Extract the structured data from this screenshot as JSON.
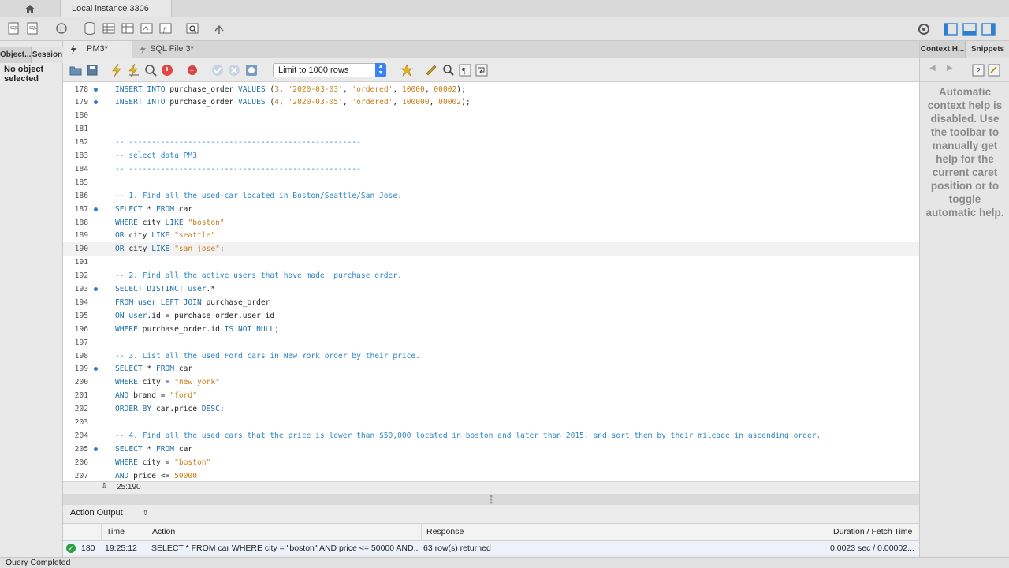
{
  "app": {
    "connection_tab": "Local instance 3306"
  },
  "left_panel": {
    "tab_objects": "Object...",
    "tab_session": "Session",
    "empty_text": "No object selected"
  },
  "editor_tabs": [
    {
      "label": "PM3*"
    },
    {
      "label": "SQL File 3*"
    }
  ],
  "editor_toolbar": {
    "limit_value": "Limit to 1000 rows"
  },
  "code_lines": [
    {
      "n": "178",
      "dot": true,
      "html": "<span class='kw'>INSERT INTO</span> purchase_order <span class='kw'>VALUES</span> (<span class='num'>3</span>, <span class='str'>'2020-03-03'</span>, <span class='str'>'ordered'</span>, <span class='num'>10000</span>, <span class='num'>00002</span>);"
    },
    {
      "n": "179",
      "dot": true,
      "html": "<span class='kw'>INSERT INTO</span> purchase_order <span class='kw'>VALUES</span> (<span class='num'>4</span>, <span class='str'>'2020-03-05'</span>, <span class='str'>'ordered'</span>, <span class='num'>100000</span>, <span class='num'>00002</span>);"
    },
    {
      "n": "180",
      "dot": false,
      "html": ""
    },
    {
      "n": "181",
      "dot": false,
      "html": ""
    },
    {
      "n": "182",
      "dot": false,
      "html": "<span class='cm'>-- ---------------------------------------------------</span>"
    },
    {
      "n": "183",
      "dot": false,
      "html": "<span class='cm'>-- select data PM3</span>"
    },
    {
      "n": "184",
      "dot": false,
      "html": "<span class='cm'>-- ---------------------------------------------------</span>"
    },
    {
      "n": "185",
      "dot": false,
      "html": ""
    },
    {
      "n": "186",
      "dot": false,
      "html": "<span class='cm'>-- 1. Find all the used-car located in Boston/Seattle/San Jose.</span>"
    },
    {
      "n": "187",
      "dot": true,
      "html": "<span class='kw'>SELECT</span> * <span class='kw'>FROM</span> car"
    },
    {
      "n": "188",
      "dot": false,
      "html": "<span class='kw'>WHERE</span> city <span class='kw'>LIKE</span> <span class='str'>\"boston\"</span>"
    },
    {
      "n": "189",
      "dot": false,
      "html": "<span class='kw'>OR</span> city <span class='kw'>LIKE</span> <span class='str'>\"seattle\"</span>"
    },
    {
      "n": "190",
      "dot": false,
      "hl": true,
      "html": "<span class='kw'>OR</span> city <span class='kw'>LIKE</span> <span class='str'>\"san jose\"</span>;"
    },
    {
      "n": "191",
      "dot": false,
      "html": ""
    },
    {
      "n": "192",
      "dot": false,
      "html": "<span class='cm'>-- 2. Find all the active users that have made  purchase order.</span>"
    },
    {
      "n": "193",
      "dot": true,
      "html": "<span class='kw'>SELECT DISTINCT user</span>.*"
    },
    {
      "n": "194",
      "dot": false,
      "html": "<span class='kw'>FROM user LEFT JOIN</span> purchase_order"
    },
    {
      "n": "195",
      "dot": false,
      "html": "<span class='kw'>ON user</span>.id = purchase_order.user_id"
    },
    {
      "n": "196",
      "dot": false,
      "html": "<span class='kw'>WHERE</span> purchase_order.id <span class='kw'>IS NOT NULL</span>;"
    },
    {
      "n": "197",
      "dot": false,
      "html": ""
    },
    {
      "n": "198",
      "dot": false,
      "html": "<span class='cm'>-- 3. List all the used Ford cars in New York order by their price.</span>"
    },
    {
      "n": "199",
      "dot": true,
      "html": "<span class='kw'>SELECT</span> * <span class='kw'>FROM</span> car"
    },
    {
      "n": "200",
      "dot": false,
      "html": "<span class='kw'>WHERE</span> city = <span class='str'>\"new york\"</span>"
    },
    {
      "n": "201",
      "dot": false,
      "html": "<span class='kw'>AND</span> brand = <span class='str'>\"ford\"</span>"
    },
    {
      "n": "202",
      "dot": false,
      "html": "<span class='kw'>ORDER BY</span> car.price <span class='kw'>DESC</span>;"
    },
    {
      "n": "203",
      "dot": false,
      "html": ""
    },
    {
      "n": "204",
      "dot": false,
      "html": "<span class='cm'>-- 4. Find all the used cars that the price is lower than $50,000 located in boston and later than 2015, and sort them by their mileage in ascending order.</span>"
    },
    {
      "n": "205",
      "dot": true,
      "html": "<span class='kw'>SELECT</span> * <span class='kw'>FROM</span> car"
    },
    {
      "n": "206",
      "dot": false,
      "html": "<span class='kw'>WHERE</span> city = <span class='str'>\"boston\"</span>"
    },
    {
      "n": "207",
      "dot": false,
      "html": "<span class='kw'>AND</span> price &lt;= <span class='num'>50000</span>"
    }
  ],
  "editor_status": {
    "cursor_position": "25:190"
  },
  "output": {
    "selector_label": "Action Output",
    "columns": [
      "Time",
      "Action",
      "Response",
      "Duration / Fetch Time"
    ],
    "rows": [
      {
        "index": "180",
        "time": "19:25:12",
        "action": "SELECT * FROM car WHERE city = \"boston\" AND price <= 50000 AND...",
        "response": "63 row(s) returned",
        "duration": "0.0023 sec / 0.00002..."
      }
    ]
  },
  "right_panel": {
    "tab_context": "Context H...",
    "tab_snippets": "Snippets",
    "help_text": "Automatic context help is disabled. Use the toolbar to manually get help for the current caret position or to toggle automatic help."
  },
  "status_bar": {
    "text": "Query Completed"
  },
  "colors": {
    "keyword": "#1c6ea4",
    "string": "#c57e18",
    "comment": "#2f86c5",
    "success": "#2ea043"
  }
}
